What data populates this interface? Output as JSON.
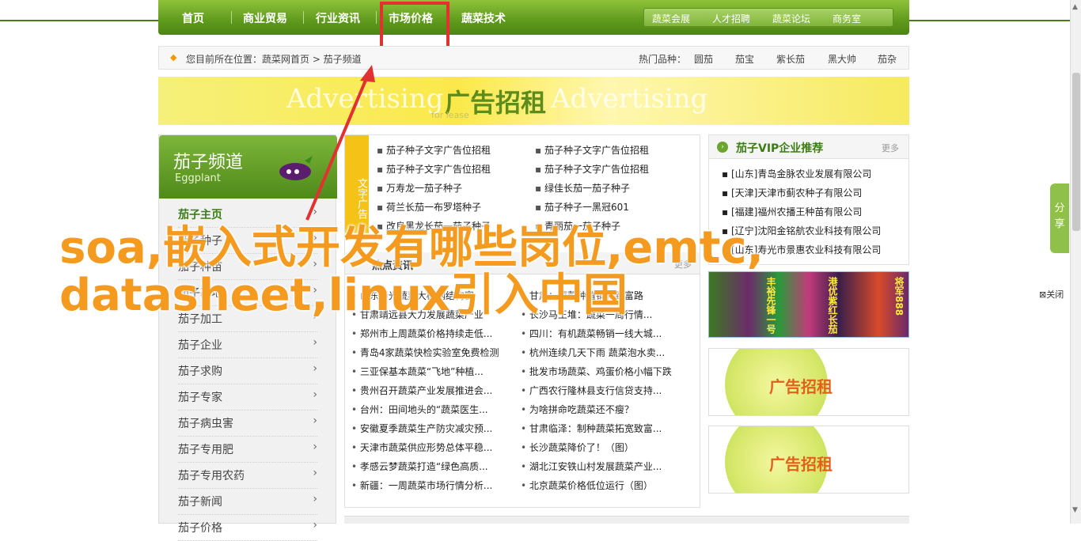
{
  "nav": {
    "items": [
      "首页",
      "商业贸易",
      "行业资讯",
      "市场价格",
      "蔬菜技术"
    ],
    "right": [
      "蔬菜会展",
      "人才招聘",
      "蔬菜论坛",
      "商务室"
    ]
  },
  "breadcrumb": {
    "icon": "diamond-icon",
    "text": "您目前所在位置：蔬菜网首页 > 茄子频道",
    "hot_label": "热门品种：",
    "hot": [
      "圆茄",
      "茄宝",
      "紫长茄",
      "黑大帅",
      "茄杂"
    ]
  },
  "banner": {
    "main": "广告招租",
    "ghost": "Advertising",
    "sub": "for lease"
  },
  "sidebar": {
    "title": "茄子频道",
    "subtitle": "Eggplant",
    "items": [
      "茄子主页",
      "茄子种子",
      "茄子种苗",
      "茄子基地",
      "茄子加工",
      "茄子企业",
      "茄子求购",
      "茄子专家",
      "茄子病虫害",
      "茄子专用肥",
      "茄子专用农药",
      "茄子新闻",
      "茄子价格"
    ]
  },
  "text_ads": {
    "tag": "文字广告",
    "left": [
      "茄子种子文字广告位招租",
      "茄子种子文字广告位招租",
      "万寿龙一茄子种子",
      "荷兰长茄一布罗塔种子",
      "改良黑龙长茄一茄子种子"
    ],
    "right": [
      "茄子种子文字广告位招租",
      "茄子种子文字广告位招租",
      "绿佳长茄一茄子种子",
      "茄子种子一黑冠601",
      "青丽茄一茄子种子"
    ]
  },
  "hot_news": {
    "title": "热点资讯",
    "more": "更多",
    "left": [
      "山东寿光蔬菜大棚钢结构富",
      "甘肃靖远县大力发展蔬菜产业",
      "郑州市上周蔬菜价格持续走低...",
      "青岛4家蔬菜快检实验室免费检测",
      "三亚保基本蔬菜“飞地”种植...",
      "贵州召开蔬菜产业发展推进会...",
      "台州：田间地头的“蔬菜医生...",
      "安徽夏季蔬菜生产防灾减灾预...",
      "天津市蔬菜供应形势总体平稳...",
      "孝感云梦蔬菜打造“绿色高质...",
      "新疆：一周蔬菜市场行情分析..."
    ],
    "right": [
      "甘肃：蔬菜种植铺就致富路",
      "长沙马王堆：蔬菜一周行情...",
      "四川：有机蔬菜畅销一线大城...",
      "杭州连续几天下雨 蔬菜泡水卖...",
      "批发市场蔬菜、鸡蛋价格小幅下跌",
      "广西农行隆林县支行信贷支持...",
      "为啥拼命吃蔬菜还不瘦？",
      "甘肃临泽：制种蔬菜拓宽致富...",
      "长沙蔬菜降价了！（图）",
      "湖北江安铁山村发展蔬菜产业...",
      "北京蔬菜价格低位运行（图）"
    ]
  },
  "vip": {
    "title": "茄子VIP企业推荐",
    "more": "更多",
    "items": [
      "[山东]青岛金脉农业发展有限公司",
      "[天津]天津市蓟农种子有限公司",
      "[福建]福州农播王种苗有限公司",
      "[辽宁]沈阳金铭航农业科技有限公司",
      "[山东]寿光市景惠农业科技有限公司"
    ]
  },
  "product_labels": [
    "丰裕先锋一号",
    "港优紫红长茄",
    "将军888"
  ],
  "ads": [
    "广告招租",
    "广告招租"
  ],
  "share": "分享",
  "close": "关闭",
  "overlay": [
    "soa,嵌入式开发有哪些岗位,emtc,",
    "datasheet,linux引入中国"
  ]
}
